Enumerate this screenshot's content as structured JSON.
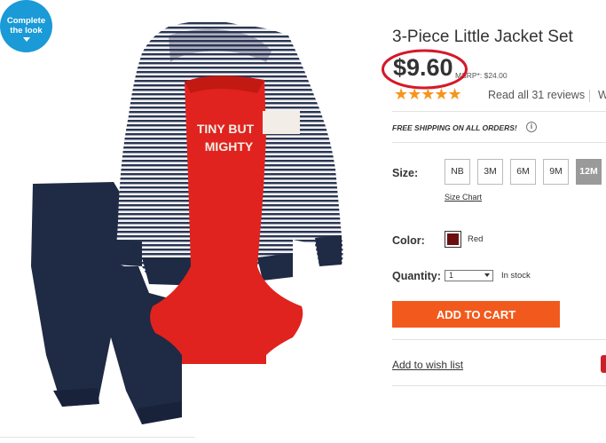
{
  "complete_look": {
    "line1": "Complete",
    "line2": "the look"
  },
  "product": {
    "title": "3-Piece Little Jacket Set",
    "price": "$9.60",
    "msrp": "MSRP*: $24.00",
    "stars": "★★★★★",
    "rating_out_of_5": 5,
    "reviews_link": "Read all 31 reviews",
    "write_fragment": "W",
    "shipping": "FREE SHIPPING ON ALL ORDERS!",
    "info_icon": "i",
    "graphic_text": "TINY BUT MIGHTY"
  },
  "size": {
    "label": "Size:",
    "options": [
      "NB",
      "3M",
      "6M",
      "9M",
      "12M"
    ],
    "selected": "12M",
    "chart_link": "Size Chart"
  },
  "color": {
    "label": "Color:",
    "name": "Red",
    "swatch": "#6b0f10"
  },
  "quantity": {
    "label": "Quantity:",
    "value": "1",
    "stock": "In stock"
  },
  "actions": {
    "add_to_cart": "ADD TO CART",
    "wishlist": "Add to wish list"
  },
  "colors": {
    "accent_blue": "#1a9ad6",
    "cart_orange": "#f25a1d",
    "star_orange": "#f7941d",
    "highlight_red": "#d4192a",
    "body_red": "#e0231e",
    "navy": "#1f2a44"
  }
}
